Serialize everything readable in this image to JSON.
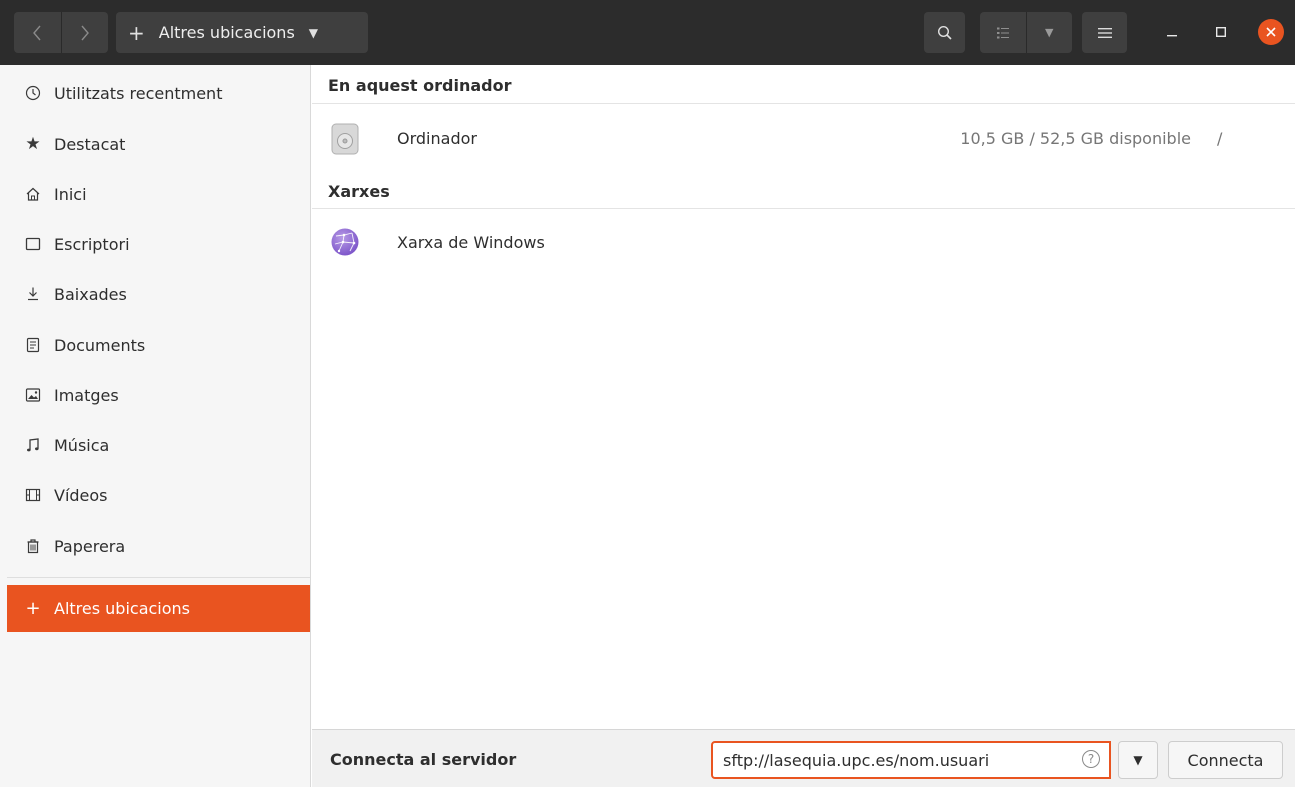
{
  "header": {
    "location_label": "Altres ubicacions",
    "location_icon": "plus-icon"
  },
  "sidebar": {
    "items": [
      {
        "label": "Utilitzats recentment",
        "icon": "clock-icon"
      },
      {
        "label": "Destacat",
        "icon": "star-icon"
      },
      {
        "label": "Inici",
        "icon": "home-icon"
      },
      {
        "label": "Escriptori",
        "icon": "desktop-icon"
      },
      {
        "label": "Baixades",
        "icon": "download-icon"
      },
      {
        "label": "Documents",
        "icon": "document-icon"
      },
      {
        "label": "Imatges",
        "icon": "image-icon"
      },
      {
        "label": "Música",
        "icon": "music-icon"
      },
      {
        "label": "Vídeos",
        "icon": "video-icon"
      },
      {
        "label": "Paperera",
        "icon": "trash-icon"
      }
    ],
    "active_item": {
      "label": "Altres ubicacions",
      "icon": "plus-icon"
    }
  },
  "main": {
    "sections": [
      {
        "title": "En aquest ordinador",
        "rows": [
          {
            "name": "Ordinador",
            "info": "10,5 GB / 52,5 GB disponible",
            "mount": "/",
            "icon": "drive-icon"
          }
        ]
      },
      {
        "title": "Xarxes",
        "rows": [
          {
            "name": "Xarxa de Windows",
            "icon": "network-globe-icon"
          }
        ]
      }
    ]
  },
  "bottom": {
    "label": "Connecta al servidor",
    "server_value": "sftp://lasequia.upc.es/nom.usuari",
    "connect_label": "Connecta"
  },
  "colors": {
    "accent": "#e95420",
    "header_bg": "#2c2c2c",
    "sidebar_bg": "#f6f6f6"
  }
}
